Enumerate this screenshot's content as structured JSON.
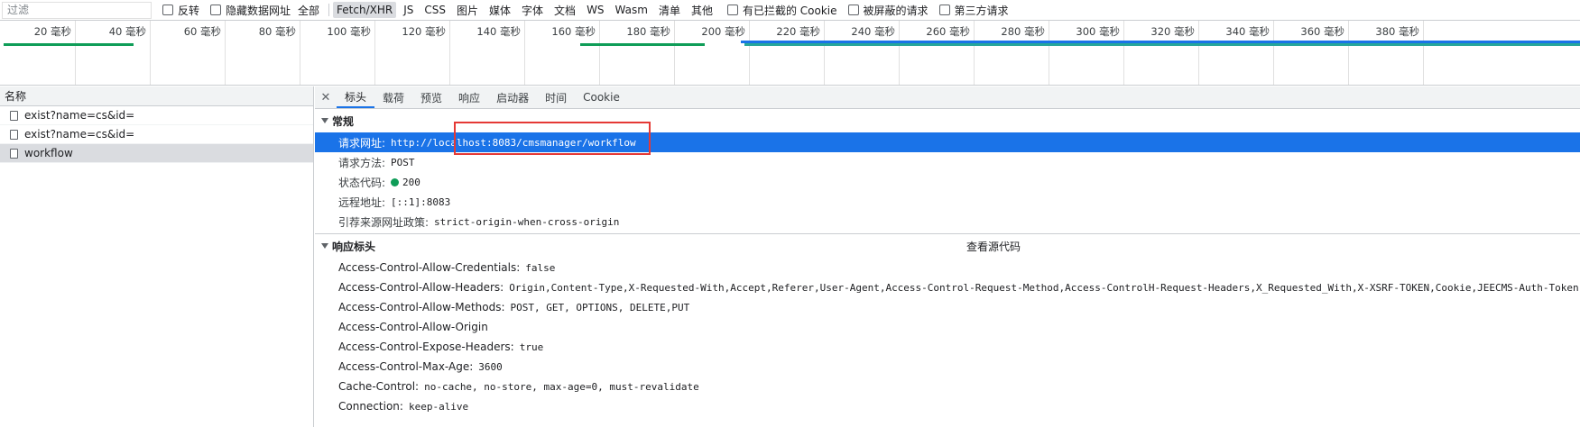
{
  "filter": {
    "placeholder": "过滤",
    "invert_label": "反转",
    "hide_data_urls_label": "隐藏数据网址",
    "types": [
      "全部",
      "Fetch/XHR",
      "JS",
      "CSS",
      "图片",
      "媒体",
      "字体",
      "文档",
      "WS",
      "Wasm",
      "清单",
      "其他"
    ],
    "active_type": "Fetch/XHR",
    "blocked_cookies_label": "有已拦截的 Cookie",
    "blocked_requests_label": "被屏蔽的请求",
    "third_party_label": "第三方请求"
  },
  "timeline": {
    "ticks": [
      "20 毫秒",
      "40 毫秒",
      "60 毫秒",
      "80 毫秒",
      "100 毫秒",
      "120 毫秒",
      "140 毫秒",
      "160 毫秒",
      "180 毫秒",
      "200 毫秒",
      "220 毫秒",
      "240 毫秒",
      "260 毫秒",
      "280 毫秒",
      "300 毫秒",
      "320 毫秒",
      "340 毫秒",
      "360 毫秒",
      "380 毫秒"
    ],
    "colors": {
      "green": "#0f9d58",
      "blue": "#1a73e8",
      "teal": "#26a69a"
    }
  },
  "requests": {
    "header": "名称",
    "items": [
      {
        "name": "exist?name=cs&id="
      },
      {
        "name": "exist?name=cs&id="
      },
      {
        "name": "workflow"
      }
    ]
  },
  "detail": {
    "tabs": [
      "标头",
      "载荷",
      "预览",
      "响应",
      "启动器",
      "时间",
      "Cookie"
    ],
    "active_tab": "标头",
    "general": {
      "title": "常规",
      "rows": [
        {
          "key": "请求网址:",
          "value": "http://localhost:8083/cmsmanager/workflow"
        },
        {
          "key": "请求方法:",
          "value": "POST"
        },
        {
          "key": "状态代码:",
          "value": "200"
        },
        {
          "key": "远程地址:",
          "value": "[::1]:8083"
        },
        {
          "key": "引荐来源网址政策:",
          "value": "strict-origin-when-cross-origin"
        }
      ]
    },
    "response_headers": {
      "title": "响应标头",
      "view_source": "查看源代码",
      "rows": [
        {
          "key": "Access-Control-Allow-Credentials:",
          "value": "false"
        },
        {
          "key": "Access-Control-Allow-Headers:",
          "value": "Origin,Content-Type,X-Requested-With,Accept,Referer,User-Agent,Access-Control-Request-Method,Access-ControlH-Request-Headers,X_Requested_With,X-XSRF-TOKEN,Cookie,JEECMS-Auth-Token,R"
        },
        {
          "key": "Access-Control-Allow-Methods:",
          "value": "POST, GET, OPTIONS, DELETE,PUT"
        },
        {
          "key": "Access-Control-Allow-Origin",
          "value": ""
        },
        {
          "key": "Access-Control-Expose-Headers:",
          "value": "true"
        },
        {
          "key": "Access-Control-Max-Age:",
          "value": "3600"
        },
        {
          "key": "Cache-Control:",
          "value": "no-cache, no-store, max-age=0, must-revalidate"
        },
        {
          "key": "Connection:",
          "value": "keep-alive"
        }
      ]
    }
  }
}
